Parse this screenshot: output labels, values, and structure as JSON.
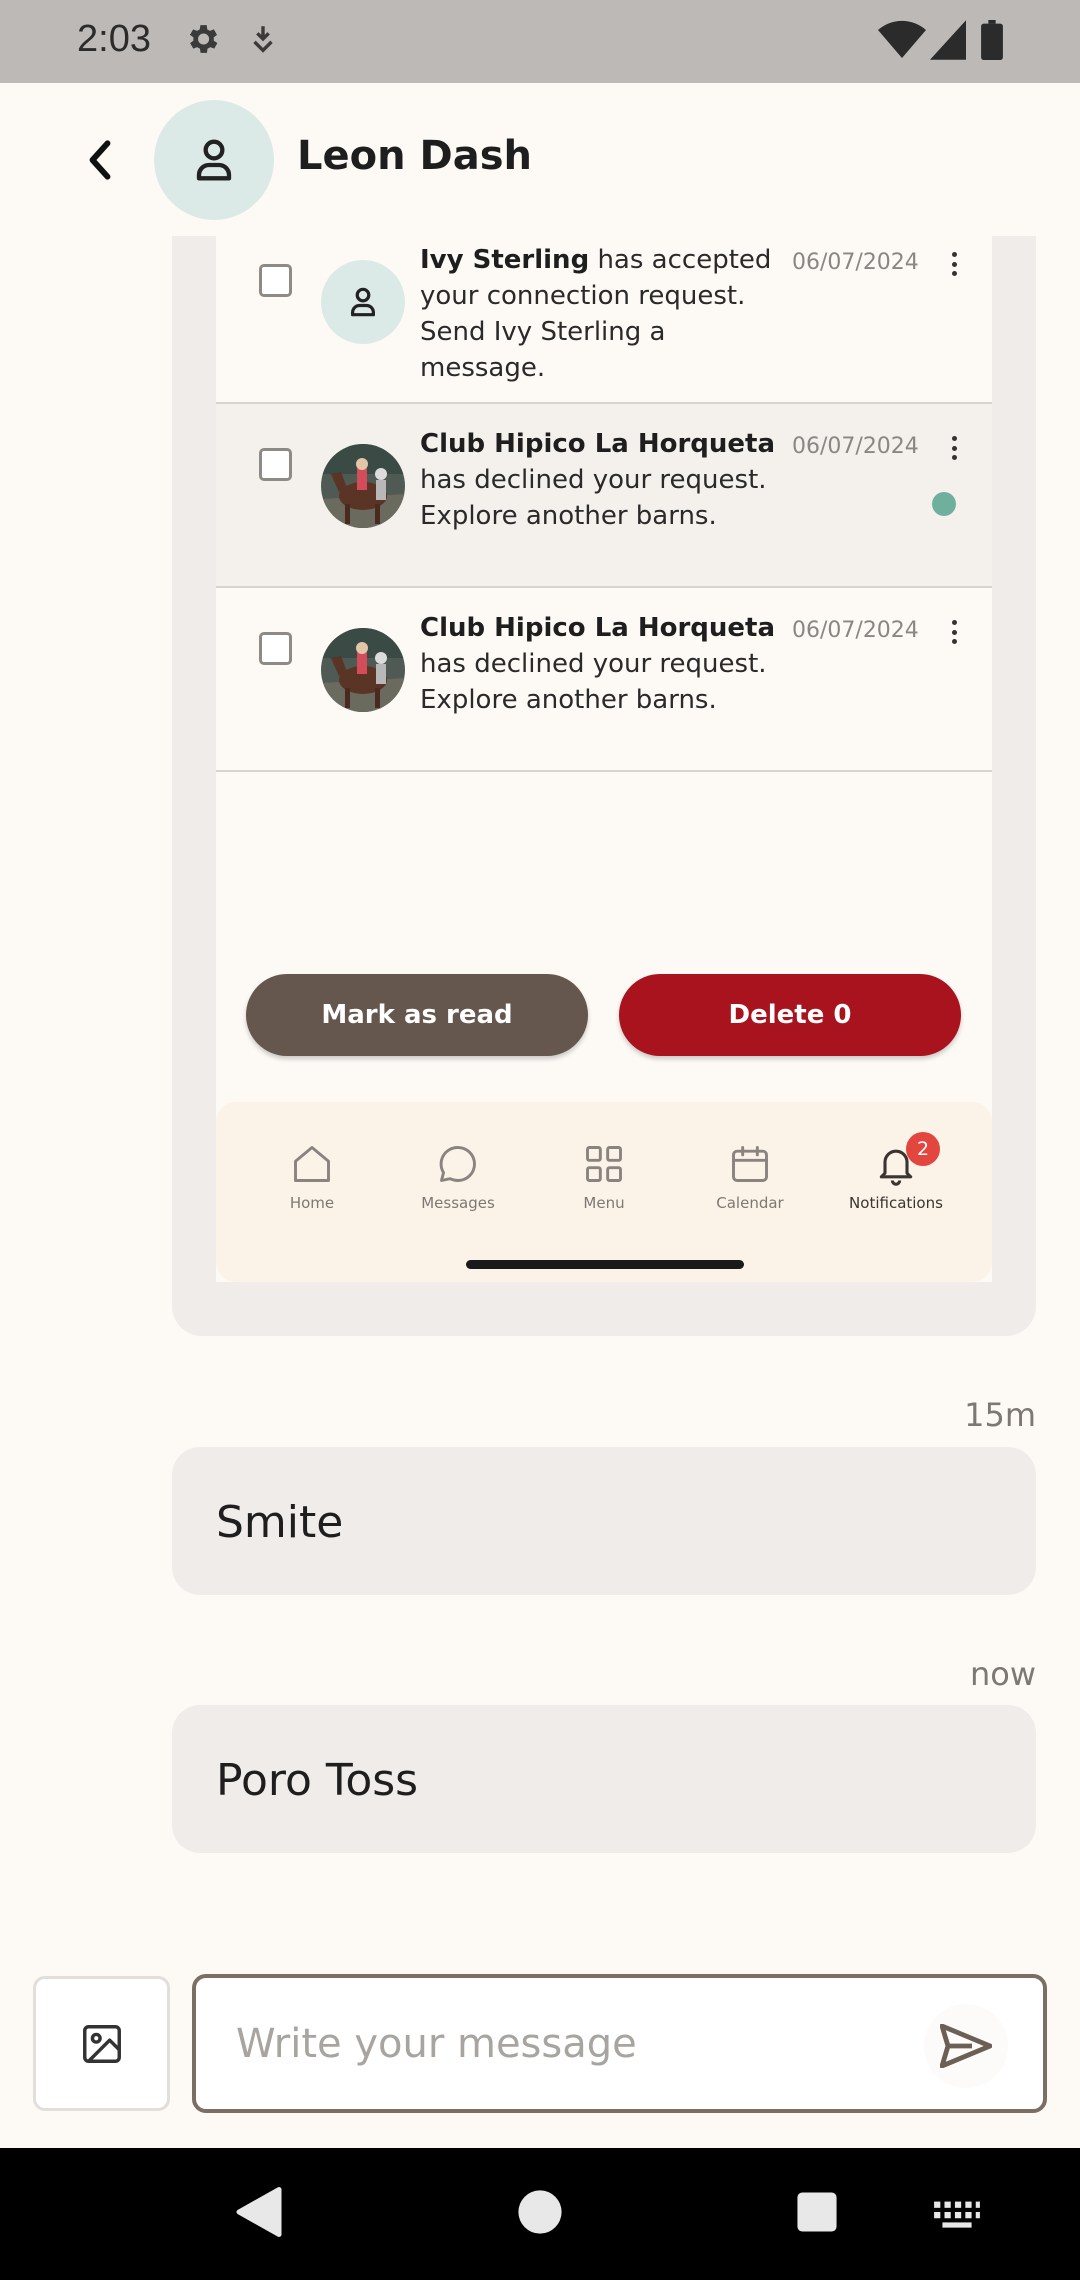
{
  "status_bar": {
    "time": "2:03",
    "left_icons": [
      "gear-icon",
      "download-shield-icon"
    ],
    "right_icons": [
      "wifi-icon",
      "signal-icon",
      "battery-icon"
    ]
  },
  "header": {
    "title": "Leon Dash",
    "back_icon": "chevron-left-icon",
    "avatar_icon": "person-icon"
  },
  "shared_screenshot": {
    "notifications": [
      {
        "name": "Ivy Sterling",
        "message": " has accepted your connection request. Send Ivy Sterling a message.",
        "date": "06/07/2024",
        "avatar": "placeholder",
        "unread": false
      },
      {
        "name": "Club Hipico La Horqueta",
        "message": " has declined your request. Explore another barns.",
        "date": "06/07/2024",
        "avatar": "photo",
        "unread": true
      },
      {
        "name": "Club Hipico La Horqueta",
        "message": " has declined your request. Explore another barns.",
        "date": "06/07/2024",
        "avatar": "photo",
        "unread": false
      }
    ],
    "mark_read_label": "Mark as read",
    "delete_label": "Delete 0",
    "nav": {
      "items": [
        {
          "label": "Home",
          "icon": "home-icon"
        },
        {
          "label": "Messages",
          "icon": "chat-bubble-icon"
        },
        {
          "label": "Menu",
          "icon": "grid-icon"
        },
        {
          "label": "Calendar",
          "icon": "calendar-icon"
        },
        {
          "label": "Notifications",
          "icon": "bell-icon"
        }
      ],
      "active": "Notifications",
      "badge_count": "2"
    }
  },
  "messages": [
    {
      "time": "15m",
      "text": "Smite"
    },
    {
      "time": "now",
      "text": "Poro Toss"
    }
  ],
  "composer": {
    "placeholder": "Write your message",
    "value": "",
    "image_icon": "image-icon",
    "send_icon": "send-icon"
  },
  "colors": {
    "background": "#FDFAF6",
    "bubble": "#EFECEA",
    "mark_read": "#65574E",
    "delete": "#A8131D",
    "unread_dot": "#6FB09D",
    "badge": "#E3453F"
  }
}
